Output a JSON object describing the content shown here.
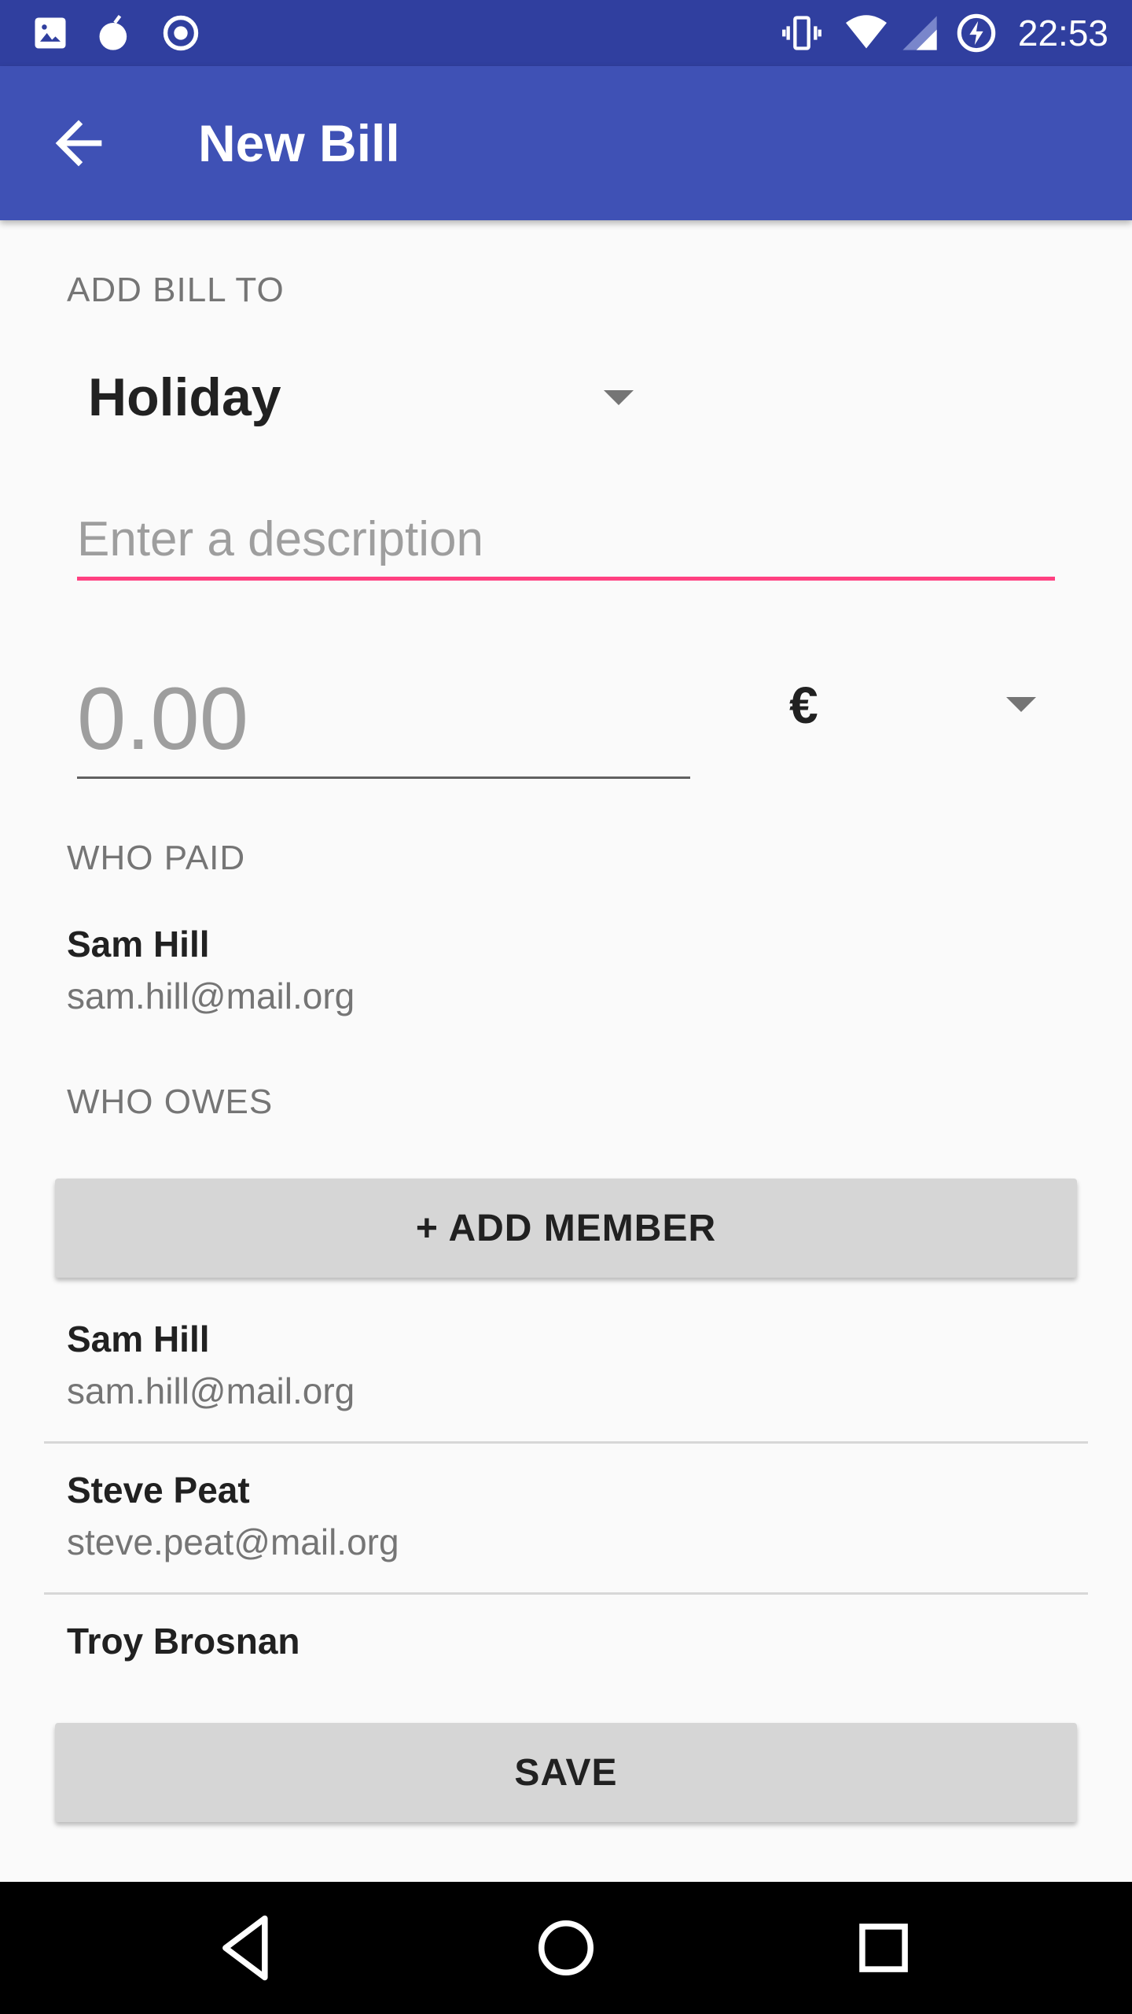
{
  "status_bar": {
    "time": "22:53",
    "left_icons": [
      "image-icon",
      "bomb-icon",
      "record-icon"
    ],
    "right_icons": [
      "vibrate-icon",
      "wifi-icon",
      "cell-signal-icon",
      "battery-charging-icon"
    ]
  },
  "app_bar": {
    "back_icon": "arrow-back-icon",
    "title": "New Bill"
  },
  "add_bill_to": {
    "label": "ADD BILL TO",
    "selected": "Holiday"
  },
  "description": {
    "placeholder": "Enter a description",
    "value": ""
  },
  "amount": {
    "placeholder": "0.00",
    "value": "",
    "currency": "€"
  },
  "who_paid": {
    "label": "WHO PAID",
    "person": {
      "name": "Sam Hill",
      "email": "sam.hill@mail.org"
    }
  },
  "who_owes": {
    "label": "WHO OWES",
    "add_member_label": "+ ADD MEMBER",
    "members": [
      {
        "name": "Sam Hill",
        "email": "sam.hill@mail.org"
      },
      {
        "name": "Steve Peat",
        "email": "steve.peat@mail.org"
      },
      {
        "name": "Troy Brosnan",
        "email": ""
      }
    ]
  },
  "save_label": "SAVE",
  "nav_bar": {
    "icons": [
      "nav-back-icon",
      "nav-home-icon",
      "nav-recents-icon"
    ]
  },
  "colors": {
    "status_bar": "#303f9f",
    "app_bar": "#3f51b5",
    "accent": "#ff4081"
  }
}
